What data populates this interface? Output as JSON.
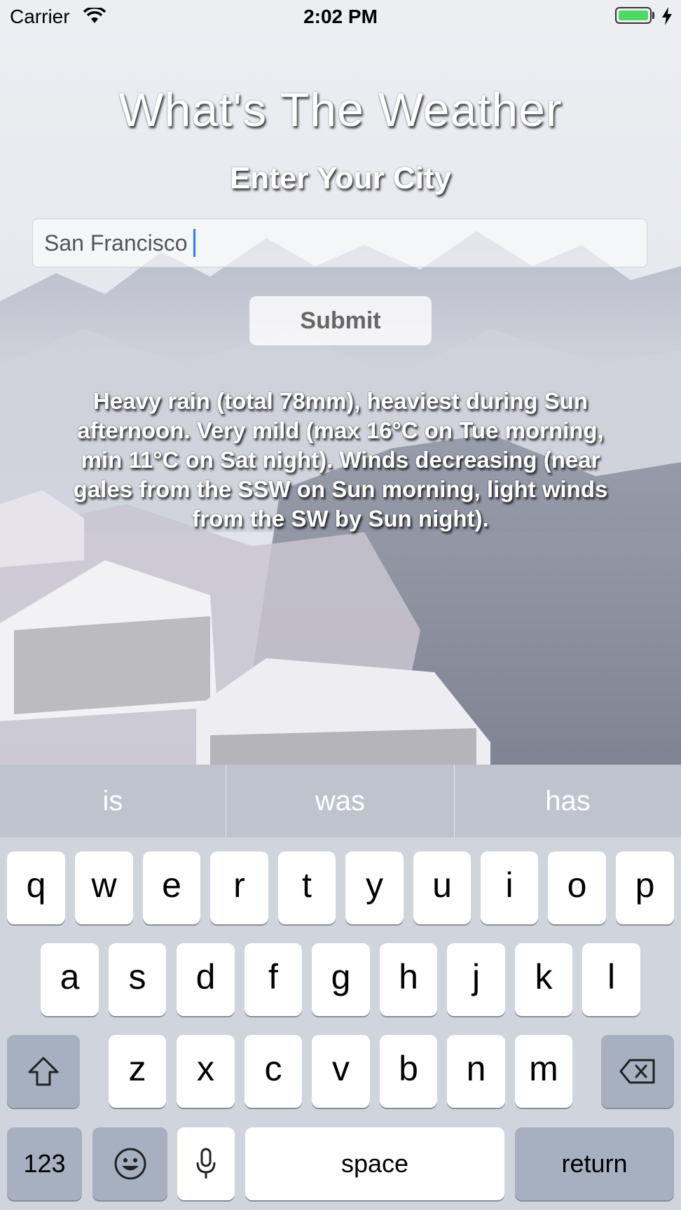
{
  "status_bar": {
    "carrier": "Carrier",
    "time": "2:02 PM"
  },
  "app": {
    "title": "What's The Weather",
    "subtitle": "Enter Your City",
    "city_input_value": "San Francisco",
    "submit_label": "Submit",
    "forecast": "Heavy rain (total 78mm), heaviest during Sun afternoon. Very mild (max 16°C on Tue morning, min 11°C on Sat night). Winds decreasing (near gales from the SSW on Sun morning, light winds from the SW by Sun night)."
  },
  "keyboard": {
    "suggestions": [
      "is",
      "was",
      "has"
    ],
    "row1": [
      "q",
      "w",
      "e",
      "r",
      "t",
      "y",
      "u",
      "i",
      "o",
      "p"
    ],
    "row2": [
      "a",
      "s",
      "d",
      "f",
      "g",
      "h",
      "j",
      "k",
      "l"
    ],
    "row3": [
      "z",
      "x",
      "c",
      "v",
      "b",
      "n",
      "m"
    ],
    "numbers_label": "123",
    "space_label": "space",
    "return_label": "return"
  },
  "colors": {
    "battery": "#4cd964",
    "caret": "#3478f6",
    "keyboard_bg": "#d0d4dc",
    "dark_key": "#a7b0c0"
  }
}
